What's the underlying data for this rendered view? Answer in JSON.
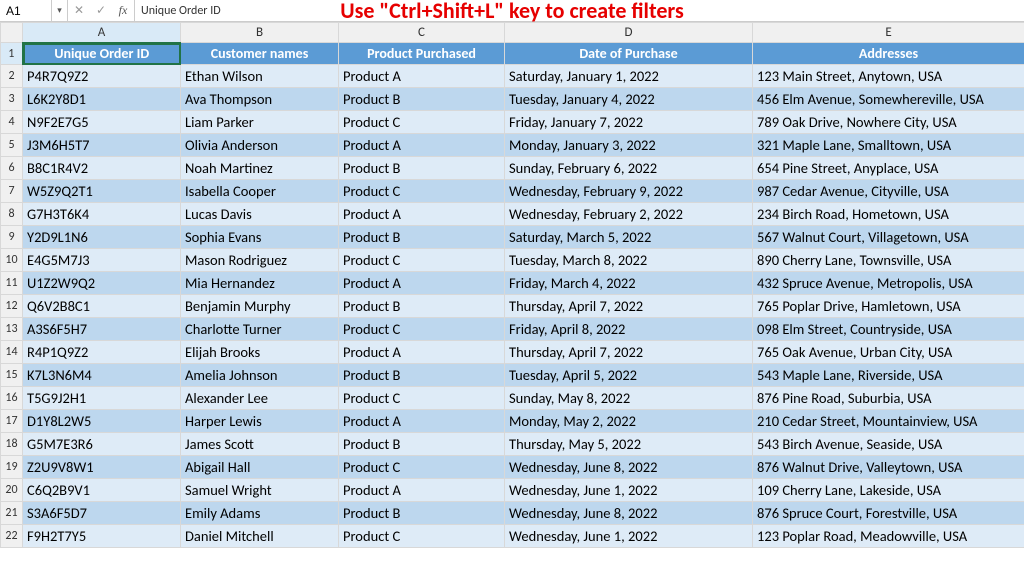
{
  "formula_bar": {
    "name_box": "A1",
    "dropdown_glyph": "▾",
    "cancel_glyph": "✕",
    "enter_glyph": "✓",
    "fx_label": "fx",
    "content": "Unique Order ID"
  },
  "banner": "Use \"Ctrl+Shift+L\" key to create filters",
  "columns": [
    "A",
    "B",
    "C",
    "D",
    "E"
  ],
  "headers": [
    "Unique Order ID",
    "Customer names",
    "Product Purchased",
    "Date of Purchase",
    "Addresses"
  ],
  "rows": [
    {
      "n": 2,
      "id": "P4R7Q9Z2",
      "name": "Ethan Wilson",
      "product": "Product A",
      "date": "Saturday, January 1, 2022",
      "address": "123 Main Street, Anytown, USA"
    },
    {
      "n": 3,
      "id": "L6K2Y8D1",
      "name": "Ava Thompson",
      "product": "Product B",
      "date": "Tuesday, January 4, 2022",
      "address": "456 Elm Avenue, Somewhereville, USA"
    },
    {
      "n": 4,
      "id": "N9F2E7G5",
      "name": "Liam Parker",
      "product": "Product C",
      "date": "Friday, January 7, 2022",
      "address": "789 Oak Drive, Nowhere City, USA"
    },
    {
      "n": 5,
      "id": "J3M6H5T7",
      "name": "Olivia Anderson",
      "product": "Product A",
      "date": "Monday, January 3, 2022",
      "address": "321 Maple Lane, Smalltown, USA"
    },
    {
      "n": 6,
      "id": "B8C1R4V2",
      "name": "Noah Martinez",
      "product": "Product B",
      "date": "Sunday, February 6, 2022",
      "address": "654 Pine Street, Anyplace, USA"
    },
    {
      "n": 7,
      "id": "W5Z9Q2T1",
      "name": "Isabella Cooper",
      "product": "Product C",
      "date": "Wednesday, February 9, 2022",
      "address": "987 Cedar Avenue, Cityville, USA"
    },
    {
      "n": 8,
      "id": "G7H3T6K4",
      "name": "Lucas Davis",
      "product": "Product A",
      "date": "Wednesday, February 2, 2022",
      "address": "234 Birch Road, Hometown, USA"
    },
    {
      "n": 9,
      "id": "Y2D9L1N6",
      "name": "Sophia Evans",
      "product": "Product B",
      "date": "Saturday, March 5, 2022",
      "address": "567 Walnut Court, Villagetown, USA"
    },
    {
      "n": 10,
      "id": "E4G5M7J3",
      "name": "Mason Rodriguez",
      "product": "Product C",
      "date": "Tuesday, March 8, 2022",
      "address": "890 Cherry Lane, Townsville, USA"
    },
    {
      "n": 11,
      "id": "U1Z2W9Q2",
      "name": "Mia Hernandez",
      "product": "Product A",
      "date": "Friday, March 4, 2022",
      "address": "432 Spruce Avenue, Metropolis, USA"
    },
    {
      "n": 12,
      "id": "Q6V2B8C1",
      "name": "Benjamin Murphy",
      "product": "Product B",
      "date": "Thursday, April 7, 2022",
      "address": "765 Poplar Drive, Hamletown, USA"
    },
    {
      "n": 13,
      "id": "A3S6F5H7",
      "name": "Charlotte Turner",
      "product": "Product C",
      "date": "Friday, April 8, 2022",
      "address": "098 Elm Street, Countryside, USA"
    },
    {
      "n": 14,
      "id": "R4P1Q9Z2",
      "name": "Elijah Brooks",
      "product": "Product A",
      "date": "Thursday, April 7, 2022",
      "address": "765 Oak Avenue, Urban City, USA"
    },
    {
      "n": 15,
      "id": "K7L3N6M4",
      "name": "Amelia Johnson",
      "product": "Product B",
      "date": "Tuesday, April 5, 2022",
      "address": "543 Maple Lane, Riverside, USA"
    },
    {
      "n": 16,
      "id": "T5G9J2H1",
      "name": "Alexander Lee",
      "product": "Product C",
      "date": "Sunday, May 8, 2022",
      "address": "876 Pine Road, Suburbia, USA"
    },
    {
      "n": 17,
      "id": "D1Y8L2W5",
      "name": "Harper Lewis",
      "product": "Product A",
      "date": "Monday, May 2, 2022",
      "address": "210 Cedar Street, Mountainview, USA"
    },
    {
      "n": 18,
      "id": "G5M7E3R6",
      "name": "James Scott",
      "product": "Product B",
      "date": "Thursday, May 5, 2022",
      "address": "543 Birch Avenue, Seaside, USA"
    },
    {
      "n": 19,
      "id": "Z2U9V8W1",
      "name": "Abigail Hall",
      "product": "Product C",
      "date": "Wednesday, June 8, 2022",
      "address": "876 Walnut Drive, Valleytown, USA"
    },
    {
      "n": 20,
      "id": "C6Q2B9V1",
      "name": "Samuel Wright",
      "product": "Product A",
      "date": "Wednesday, June 1, 2022",
      "address": "109 Cherry Lane, Lakeside, USA"
    },
    {
      "n": 21,
      "id": "S3A6F5D7",
      "name": "Emily Adams",
      "product": "Product B",
      "date": "Wednesday, June 8, 2022",
      "address": "876 Spruce Court, Forestville, USA"
    },
    {
      "n": 22,
      "id": "F9H2T7Y5",
      "name": "Daniel Mitchell",
      "product": "Product C",
      "date": "Wednesday, June 1, 2022",
      "address": "123 Poplar Road, Meadowville, USA"
    }
  ]
}
